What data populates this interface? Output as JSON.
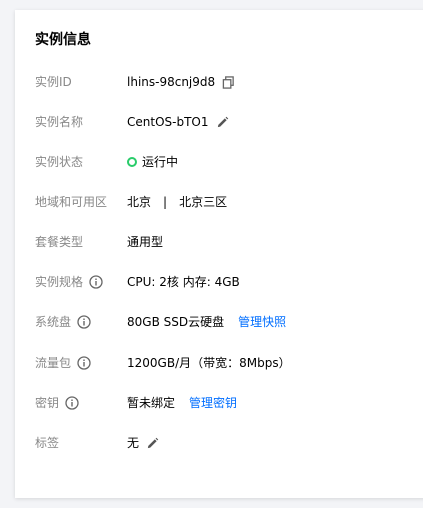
{
  "title": "实例信息",
  "colors": {
    "accent": "#006eff",
    "status_running": "#29cc6a",
    "label": "#888888"
  },
  "rows": {
    "instance_id": {
      "label": "实例ID",
      "value": "lhins-98cnj9d8",
      "icon": "copy-icon"
    },
    "instance_name": {
      "label": "实例名称",
      "value": "CentOS-bTO1",
      "icon": "edit-icon"
    },
    "instance_status": {
      "label": "实例状态",
      "value": "运行中",
      "icon": "status-running-icon"
    },
    "region": {
      "label": "地域和可用区",
      "region": "北京",
      "separator": "|",
      "zone": "北京三区"
    },
    "plan_type": {
      "label": "套餐类型",
      "value": "通用型"
    },
    "spec": {
      "label": "实例规格",
      "value": "CPU: 2核 内存: 4GB",
      "icon": "info-icon"
    },
    "system_disk": {
      "label": "系统盘",
      "value": "80GB SSD云硬盘",
      "link": "管理快照",
      "icon": "info-icon"
    },
    "traffic": {
      "label": "流量包",
      "value": "1200GB/月（带宽：8Mbps）",
      "icon": "info-icon"
    },
    "key": {
      "label": "密钥",
      "value": "暂未绑定",
      "link": "管理密钥",
      "icon": "info-icon"
    },
    "tags": {
      "label": "标签",
      "value": "无",
      "icon": "edit-icon"
    }
  }
}
